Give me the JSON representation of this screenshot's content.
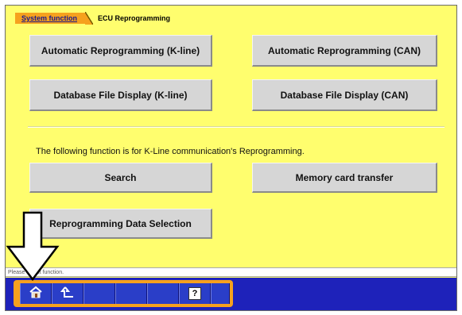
{
  "breadcrumb": {
    "items": [
      "System function",
      "ECU Reprogramming"
    ]
  },
  "buttons": {
    "auto_kline": "Automatic Reprogramming (K-line)",
    "auto_can": "Automatic Reprogramming (CAN)",
    "db_kline": "Database File Display (K-line)",
    "db_can": "Database File Display (CAN)",
    "search": "Search",
    "memory_card": "Memory card transfer",
    "data_selection": "Reprogramming Data Selection"
  },
  "note": "The following function is for K-Line communication's Reprogramming.",
  "status_text": "Please select function.",
  "toolbar": {
    "tools": [
      "home-icon",
      "back-up-icon",
      "",
      "",
      "help-icon",
      ""
    ],
    "help_label": "?"
  },
  "colors": {
    "background": "#fffe6e",
    "accent": "#f6a11e",
    "taskbar": "#1e22ba",
    "button": "#d6d6d6"
  }
}
